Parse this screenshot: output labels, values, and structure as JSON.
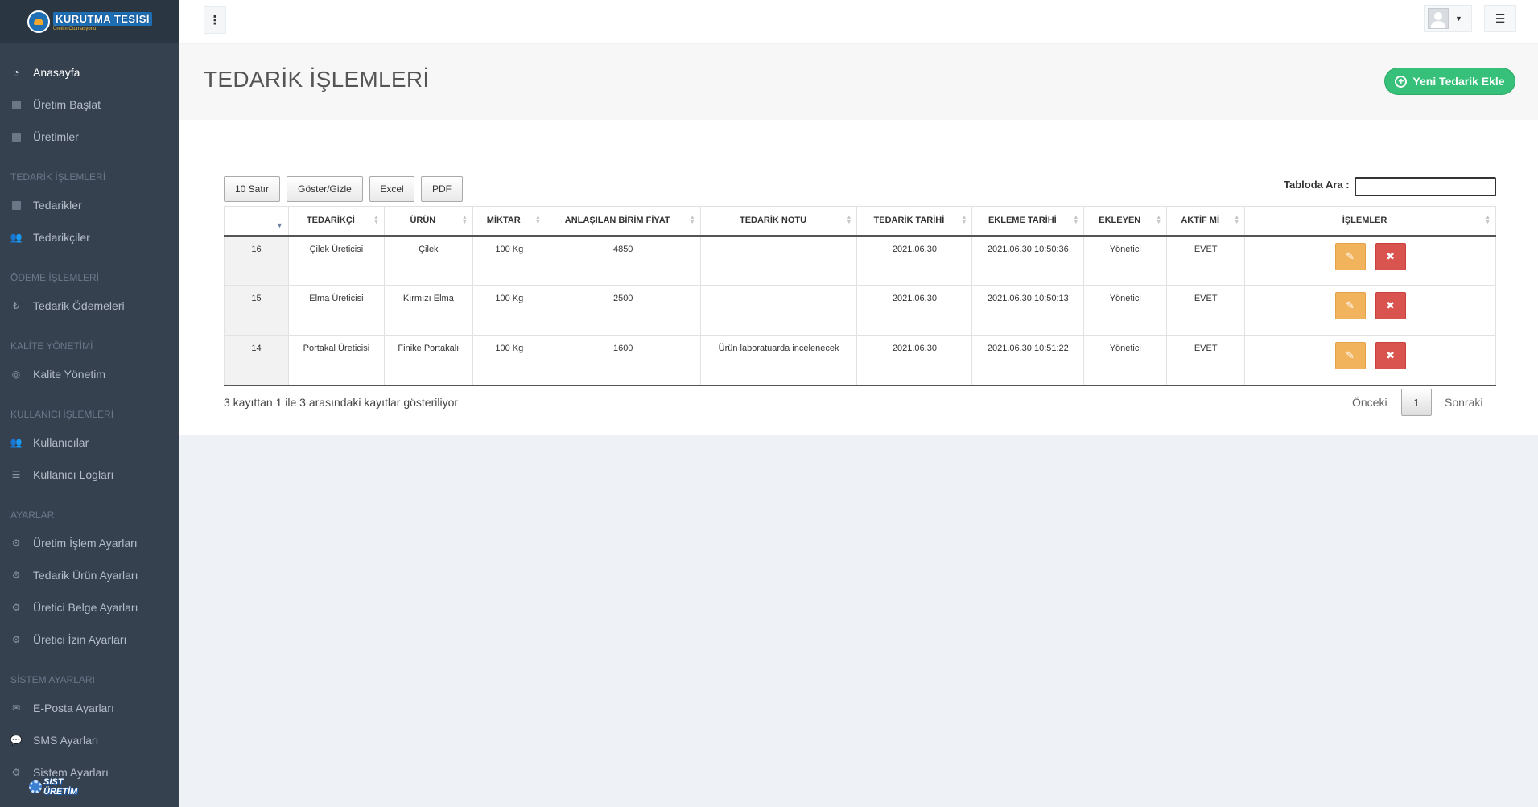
{
  "brand": {
    "logo_main": "KURUTMA TESİSİ",
    "logo_sub": "Üretim Otomasyonu",
    "bottom_logo_line1": "SIST",
    "bottom_logo_line2": "ÜRETİM"
  },
  "sidebar": {
    "items": [
      {
        "type": "item",
        "label": "Anasayfa",
        "icon": "dashboard-icon",
        "glyph": "◔",
        "active": true
      },
      {
        "type": "item",
        "label": "Üretim Başlat",
        "icon": "square-icon",
        "glyph": ""
      },
      {
        "type": "item",
        "label": "Üretimler",
        "icon": "square-icon",
        "glyph": ""
      },
      {
        "type": "heading",
        "label": "TEDARİK İŞLEMLERİ"
      },
      {
        "type": "item",
        "label": "Tedarikler",
        "icon": "square-icon",
        "glyph": ""
      },
      {
        "type": "item",
        "label": "Tedarikçiler",
        "icon": "users-icon",
        "glyph": "👥"
      },
      {
        "type": "heading",
        "label": "ÖDEME İŞLEMLERİ"
      },
      {
        "type": "item",
        "label": "Tedarik Ödemeleri",
        "icon": "money-icon",
        "glyph": "₺"
      },
      {
        "type": "heading",
        "label": "KALİTE YÖNETİMİ"
      },
      {
        "type": "item",
        "label": "Kalite Yönetim",
        "icon": "settings-circle-icon",
        "glyph": "◎"
      },
      {
        "type": "heading",
        "label": "KULLANICI İŞLEMLERİ"
      },
      {
        "type": "item",
        "label": "Kullanıcılar",
        "icon": "users-icon",
        "glyph": "👥"
      },
      {
        "type": "item",
        "label": "Kullanıcı Logları",
        "icon": "list-icon",
        "glyph": "☰"
      },
      {
        "type": "heading",
        "label": "AYARLAR"
      },
      {
        "type": "item",
        "label": "Üretim İşlem Ayarları",
        "icon": "gears-icon",
        "glyph": "⚙"
      },
      {
        "type": "item",
        "label": "Tedarik Ürün Ayarları",
        "icon": "gears-icon",
        "glyph": "⚙"
      },
      {
        "type": "item",
        "label": "Üretici Belge Ayarları",
        "icon": "gears-icon",
        "glyph": "⚙"
      },
      {
        "type": "item",
        "label": "Üretici İzin Ayarları",
        "icon": "gears-icon",
        "glyph": "⚙"
      },
      {
        "type": "heading",
        "label": "SİSTEM AYARLARI"
      },
      {
        "type": "item",
        "label": "E-Posta Ayarları",
        "icon": "envelope-icon",
        "glyph": "✉"
      },
      {
        "type": "item",
        "label": "SMS Ayarları",
        "icon": "chat-icon",
        "glyph": "💬"
      },
      {
        "type": "item",
        "label": "Sistem Ayarları",
        "icon": "gears-icon",
        "glyph": "⚙"
      }
    ]
  },
  "page": {
    "title": "TEDARİK İŞLEMLERİ",
    "add_button": "Yeni Tedarik Ekle"
  },
  "toolbar": {
    "rows": "10 Satır",
    "toggle": "Göster/Gizle",
    "excel": "Excel",
    "pdf": "PDF",
    "search_label": "Tabloda Ara :"
  },
  "table": {
    "columns": [
      "",
      "TEDARİKÇİ",
      "ÜRÜN",
      "MİKTAR",
      "ANLAŞILAN BİRİM FİYAT",
      "TEDARİK NOTU",
      "TEDARİK TARİHİ",
      "EKLEME TARİHİ",
      "EKLEYEN",
      "AKTİF Mİ",
      "İŞLEMLER"
    ],
    "rows": [
      [
        "16",
        "Çilek Üreticisi",
        "Çilek",
        "100 Kg",
        "4850",
        "",
        "2021.06.30",
        "2021.06.30 10:50:36",
        "Yönetici",
        "EVET"
      ],
      [
        "15",
        "Elma Üreticisi",
        "Kırmızı Elma",
        "100 Kg",
        "2500",
        "",
        "2021.06.30",
        "2021.06.30 10:50:13",
        "Yönetici",
        "EVET"
      ],
      [
        "14",
        "Portakal Üreticisi",
        "Finike Portakalı",
        "100 Kg",
        "1600",
        "Ürün laboratuarda incelenecek",
        "2021.06.30",
        "2021.06.30 10:51:22",
        "Yönetici",
        "EVET"
      ]
    ]
  },
  "footer": {
    "info": "3 kayıttan 1 ile 3 arasındaki kayıtlar gösteriliyor",
    "prev": "Önceki",
    "page": "1",
    "next": "Sonraki"
  }
}
